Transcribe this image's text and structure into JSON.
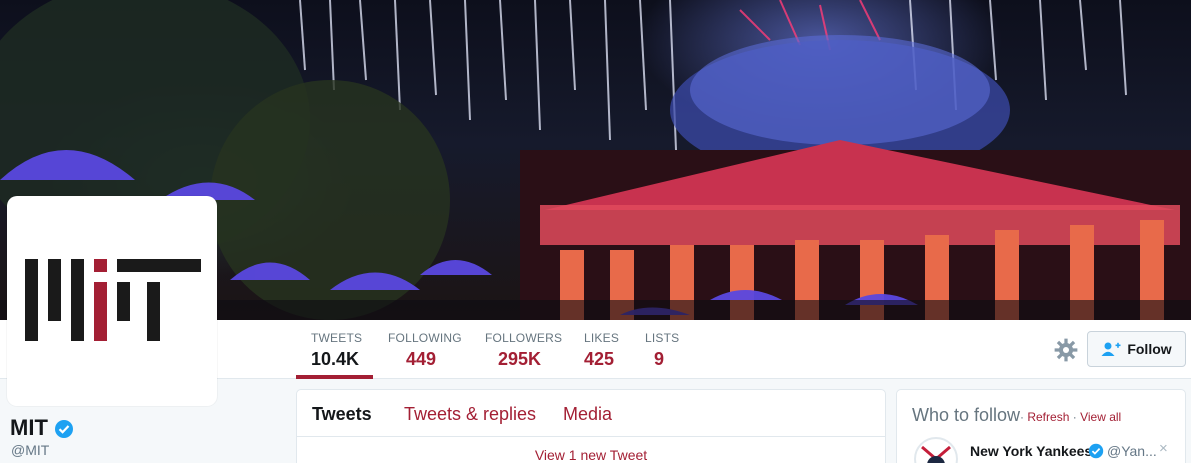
{
  "profile": {
    "name": "MIT",
    "handle": "@MIT"
  },
  "stats": [
    {
      "label": "TWEETS",
      "value": "10.4K",
      "active": true
    },
    {
      "label": "FOLLOWING",
      "value": "449",
      "active": false
    },
    {
      "label": "FOLLOWERS",
      "value": "295K",
      "active": false
    },
    {
      "label": "LIKES",
      "value": "425",
      "active": false
    },
    {
      "label": "LISTS",
      "value": "9",
      "active": false
    }
  ],
  "actions": {
    "follow_label": "Follow"
  },
  "timeline": {
    "tabs": [
      "Tweets",
      "Tweets & replies",
      "Media"
    ],
    "new_tweet_notice": "View 1 new Tweet"
  },
  "who_to_follow": {
    "title": "Who to follow",
    "dot": "·",
    "refresh": "Refresh",
    "view_all": "View all",
    "suggestion": {
      "name": "New York Yankees",
      "handle": "@Yan...",
      "close": "×"
    }
  },
  "colors": {
    "accent": "#a31f34",
    "verified": "#1da1f2"
  }
}
